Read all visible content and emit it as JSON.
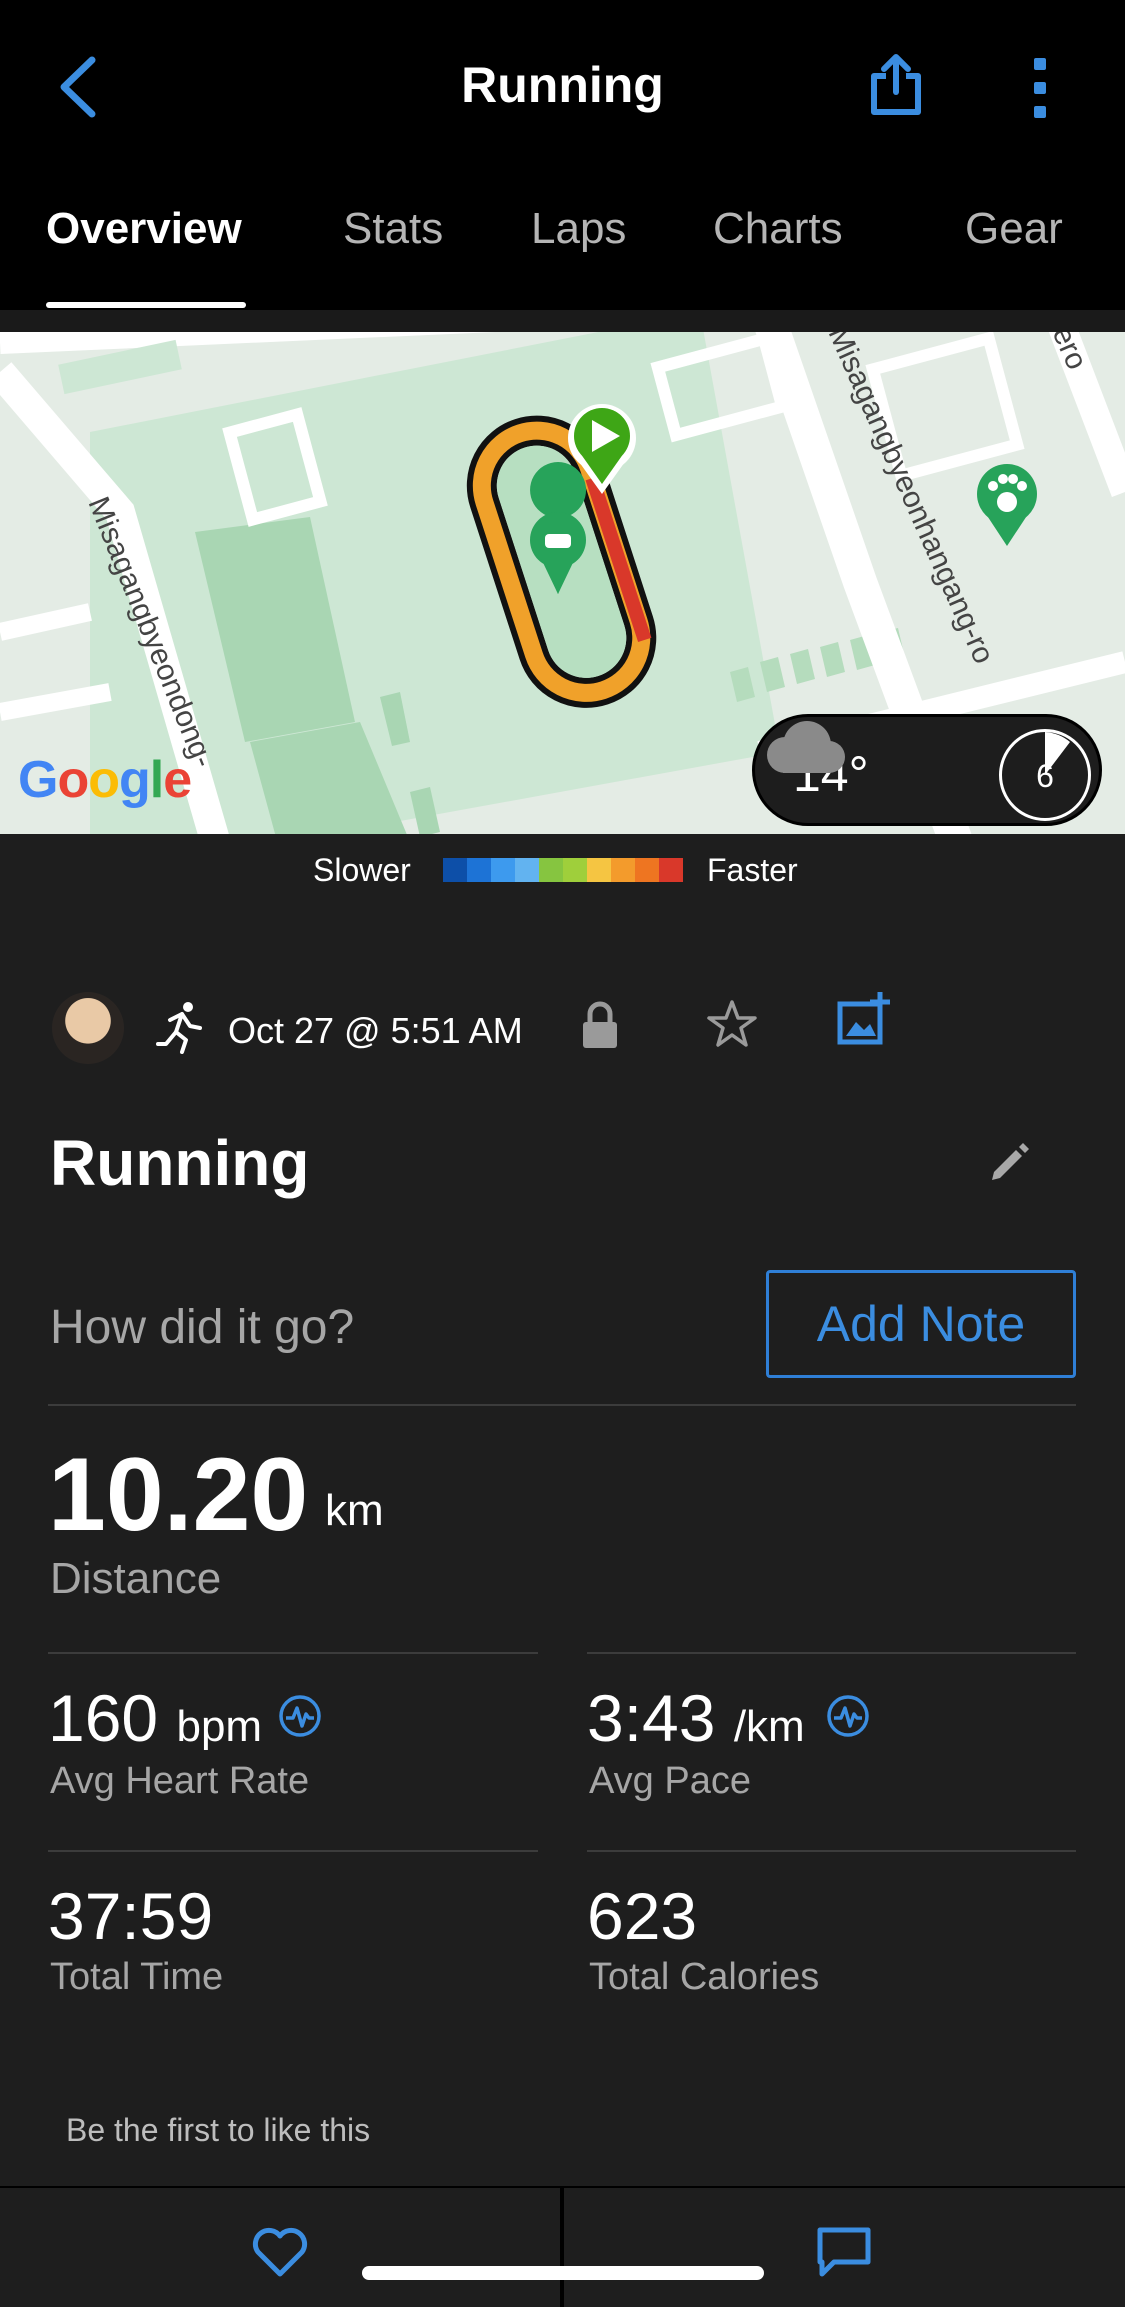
{
  "header": {
    "title": "Running",
    "back_icon": "chevron-left-icon",
    "share_icon": "share-icon",
    "more_icon": "more-vertical-icon"
  },
  "tabs": [
    {
      "label": "Overview",
      "active": true
    },
    {
      "label": "Stats",
      "active": false
    },
    {
      "label": "Laps",
      "active": false
    },
    {
      "label": "Charts",
      "active": false
    },
    {
      "label": "Gear",
      "active": false
    }
  ],
  "map": {
    "street_left": "Misagangbyeondong-",
    "street_right": "Misagangbyeonhangang-ro",
    "street_top_right": "ero",
    "google_logo": "Google",
    "weather": {
      "temperature": "14°",
      "condition_icon": "cloud-icon",
      "wind": "6"
    }
  },
  "legend": {
    "slower_label": "Slower",
    "faster_label": "Faster",
    "colors": [
      "#0d4fa8",
      "#1d73d6",
      "#3d9aee",
      "#62b3f0",
      "#86c540",
      "#9fcf3b",
      "#f5c542",
      "#f39b2c",
      "#ee7521",
      "#d9382a"
    ]
  },
  "activity": {
    "date": "Oct 27 @ 5:51 AM",
    "type_icon": "running-icon",
    "name": "Running",
    "note_prompt": "How did it go?",
    "add_note_label": "Add Note"
  },
  "stats": {
    "distance": {
      "value": "10.20",
      "unit": "km",
      "label": "Distance"
    },
    "avg_heart_rate": {
      "value": "160",
      "unit": "bpm",
      "label": "Avg Heart Rate"
    },
    "avg_pace": {
      "value": "3:43",
      "unit": "/km",
      "label": "Avg Pace"
    },
    "total_time": {
      "value": "37:59",
      "label": "Total Time"
    },
    "total_calories": {
      "value": "623",
      "label": "Total Calories"
    }
  },
  "social": {
    "likes_text": "Be the first to like this"
  },
  "colors": {
    "accent": "#3b8de0",
    "background": "#1e1e1e",
    "header": "#000000"
  }
}
